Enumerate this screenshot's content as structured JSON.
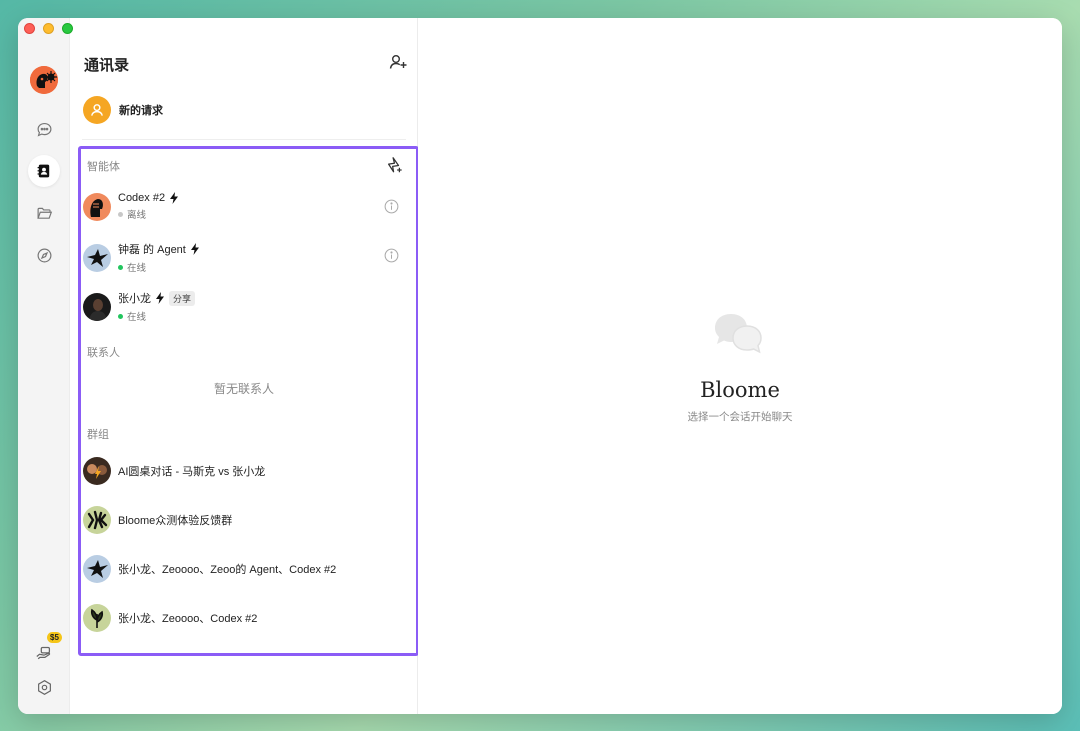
{
  "window": {
    "traffic_lights": [
      "close",
      "minimize",
      "zoom"
    ]
  },
  "rail": {
    "items": [
      "chat-icon",
      "contacts-icon",
      "folder-icon",
      "compass-icon"
    ],
    "active": "contacts-icon",
    "badge": "$5",
    "bottom": [
      "wallet-icon",
      "settings-icon"
    ]
  },
  "contacts": {
    "title": "通讯录",
    "new_request": "新的请求",
    "agents_label": "智能体",
    "agents": [
      {
        "name": "Codex #2",
        "status": "离线",
        "online": false,
        "info": true
      },
      {
        "name": "钟磊 的 Agent",
        "status": "在线",
        "online": true,
        "info": true
      },
      {
        "name": "张小龙",
        "status": "在线",
        "online": true,
        "tag": "分享"
      }
    ],
    "contacts_label": "联系人",
    "contacts_empty": "暂无联系人",
    "groups_label": "群组",
    "groups": [
      {
        "name": "AI圆桌对话 - 马斯克 vs 张小龙"
      },
      {
        "name": "Bloome众测体验反馈群"
      },
      {
        "name": "张小龙、Zeoooo、Zeoo的 Agent、Codex #2"
      },
      {
        "name": "张小龙、Zeoooo、Codex #2"
      }
    ]
  },
  "main": {
    "brand": "Bloome",
    "hint": "选择一个会话开始聊天"
  },
  "colors": {
    "highlight": "#8b5cf6",
    "online": "#22c55e",
    "request_avatar": "#f5a623",
    "badge": "#f5c518"
  }
}
